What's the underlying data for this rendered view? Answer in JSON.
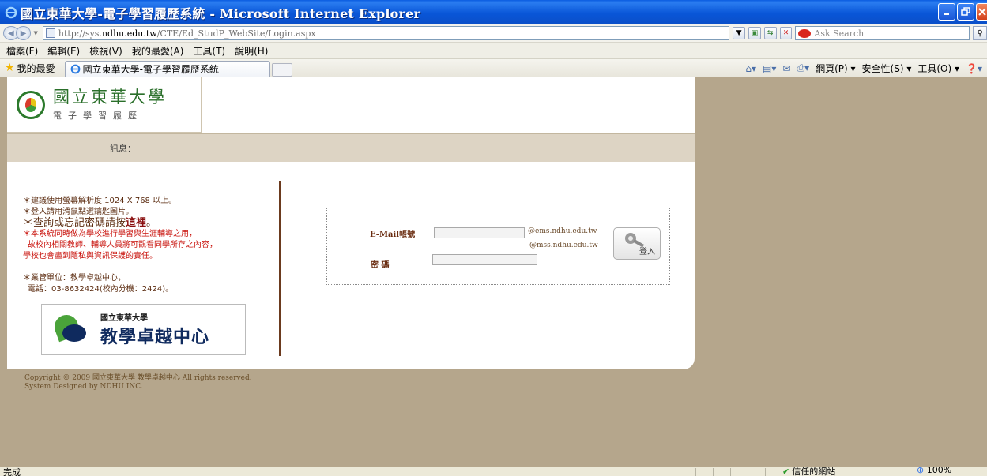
{
  "window": {
    "title": "國立東華大學-電子學習履歷系統 - Microsoft Internet Explorer"
  },
  "address": {
    "url_prefix": "http://sys.",
    "url_domain": "ndhu.edu.tw",
    "url_path": "/CTE/Ed_StudP_WebSite/Login.aspx",
    "search_placeholder": "Ask Search"
  },
  "menu": [
    "檔案(F)",
    "編輯(E)",
    "檢視(V)",
    "我的最愛(A)",
    "工具(T)",
    "說明(H)"
  ],
  "tabs": {
    "favorites_label": "我的最愛",
    "active_tab": "國立東華大學-電子學習履歷系統"
  },
  "commandbar": {
    "page": "網頁(P) ▾",
    "safety": "安全性(S) ▾",
    "tools": "工具(O) ▾"
  },
  "site": {
    "logo_main": "國立東華大學",
    "logo_sub": "電子學習履歷",
    "message_label": "訊息："
  },
  "info": {
    "line1": "＊建議使用螢幕解析度 1024 X 768 以上。",
    "line2": "＊登入請用滑鼠點選鑰匙圖片。",
    "line3_pre": "＊查詢或忘記密碼請按",
    "line3_link": "這裡",
    "line3_post": "。",
    "line4": "＊本系統同時做為學校進行學習與生涯輔導之用，",
    "line5": "故校內相關教師、輔導人員將可觀看同學所存之內容，",
    "line6": "學校也會盡到隱私與資訊保護的責任。",
    "line7": "＊業管單位：教學卓越中心，",
    "line8": "電話：03-8632424(校內分機：2424)。"
  },
  "cte_logo": {
    "small": "國立東華大學",
    "big": "教學卓越中心"
  },
  "login": {
    "email_label": "E-Mail帳號",
    "email_value": "",
    "domain1": "@ems.ndhu.edu.tw",
    "domain2": "@mss.ndhu.edu.tw",
    "password_label": "密 碼",
    "password_value": "",
    "button_label": "登入"
  },
  "footer": {
    "line1": "Copyright © 2009 國立東華大學 教學卓越中心 All rights reserved.",
    "line2": "System Designed by NDHU INC."
  },
  "status": {
    "text": "完成",
    "zone": "信任的網站",
    "zoom": "100%"
  }
}
